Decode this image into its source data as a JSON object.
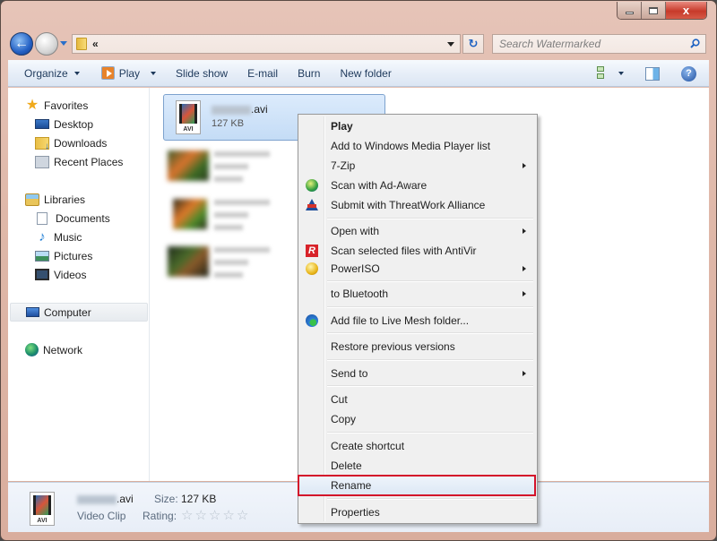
{
  "window": {
    "caption_buttons": {
      "minimize": "minimize",
      "maximize": "maximize",
      "close": "x"
    }
  },
  "address_bar": {
    "path_prefix": "«",
    "refresh_icon": "↻",
    "search_placeholder": "Search Watermarked"
  },
  "toolbar": {
    "organize": "Organize",
    "play": "Play",
    "slide_show": "Slide show",
    "email": "E-mail",
    "burn": "Burn",
    "new_folder": "New folder",
    "help": "?"
  },
  "nav_pane": {
    "favorites": {
      "label": "Favorites",
      "items": [
        "Desktop",
        "Downloads",
        "Recent Places"
      ]
    },
    "libraries": {
      "label": "Libraries",
      "items": [
        "Documents",
        "Music",
        "Pictures",
        "Videos"
      ]
    },
    "computer": "Computer",
    "network": "Network"
  },
  "files": {
    "selected": {
      "name_suffix": ".avi",
      "size": "127 KB",
      "type_badge": "AVI"
    },
    "others_count": 3
  },
  "context_menu": {
    "items": [
      {
        "label": "Play",
        "bold": true
      },
      {
        "label": "Add to Windows Media Player list"
      },
      {
        "label": "7-Zip",
        "submenu": true
      },
      {
        "label": "Scan with Ad-Aware",
        "icon": "ad-aware-icon"
      },
      {
        "label": "Submit with ThreatWork Alliance",
        "icon": "threatwork-icon"
      },
      {
        "label": "Open with",
        "submenu": true
      },
      {
        "label": "Scan selected files with AntiVir",
        "icon": "antivir-icon"
      },
      {
        "label": "PowerISO",
        "icon": "poweriso-icon",
        "submenu": true
      },
      {
        "label": "to Bluetooth",
        "submenu": true
      },
      {
        "label": "Add file to Live Mesh folder...",
        "icon": "live-mesh-icon"
      },
      {
        "label": "Restore previous versions"
      },
      {
        "label": "Send to",
        "submenu": true
      },
      {
        "label": "Cut"
      },
      {
        "label": "Copy"
      },
      {
        "label": "Create shortcut"
      },
      {
        "label": "Delete"
      },
      {
        "label": "Rename",
        "highlighted": true
      },
      {
        "label": "Properties"
      }
    ],
    "antivir_glyph": "R"
  },
  "details_pane": {
    "name_suffix": ".avi",
    "type": "Video Clip",
    "size_label": "Size:",
    "size_value": "127 KB",
    "rating_label": "Rating:",
    "rating_value": 0,
    "rating_max": 5,
    "star_glyph": "☆"
  },
  "colors": {
    "frame": "#dfb8a9",
    "toolbar_text": "#1e395b",
    "selection": "#c4dcf6",
    "highlight_border": "#d3122a"
  }
}
